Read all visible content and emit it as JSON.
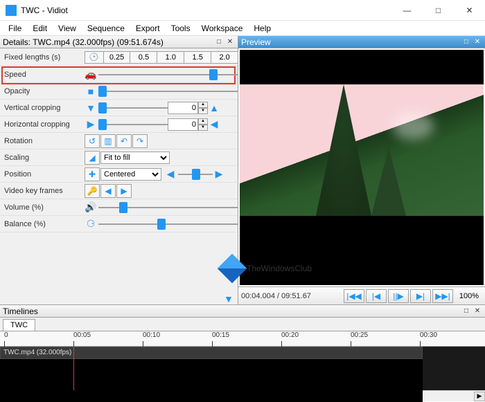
{
  "window": {
    "title": "TWC - Vidiot"
  },
  "menu": [
    "File",
    "Edit",
    "View",
    "Sequence",
    "Export",
    "Tools",
    "Workspace",
    "Help"
  ],
  "details": {
    "header": "Details: TWC.mp4 (32.000fps) (09:51.674s)",
    "fixed_lengths_label": "Fixed lengths (s)",
    "fixed_lengths": [
      "0.25",
      "0.5",
      "1.0",
      "1.5",
      "2.0"
    ],
    "speed_label": "Speed",
    "opacity_label": "Opacity",
    "vcrop_label": "Vertical cropping",
    "vcrop_value": "0",
    "hcrop_label": "Horizontal cropping",
    "hcrop_value": "0",
    "rotation_label": "Rotation",
    "scaling_label": "Scaling",
    "scaling_value": "Fit to fill",
    "position_label": "Position",
    "position_value": "Centered",
    "vkf_label": "Video key frames",
    "volume_label": "Volume (%)",
    "balance_label": "Balance (%)"
  },
  "preview": {
    "header": "Preview",
    "time": "00:04.004 / 09:51.67",
    "zoom": "100%"
  },
  "timelines": {
    "header": "Timelines",
    "tab": "TWC",
    "ticks": [
      "0",
      "00:05",
      "00:10",
      "00:15",
      "00:20",
      "00:25",
      "00:30"
    ],
    "clip_label": "TWC.mp4 (32.000fps)"
  },
  "watermark": "TheWindowsClub"
}
